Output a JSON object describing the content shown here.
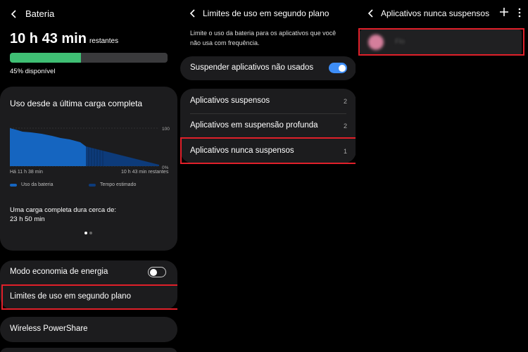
{
  "battery": {
    "title": "Bateria",
    "time_big": "10 h 43 min",
    "time_suffix": "restantes",
    "level_percent": 45,
    "available": "45% disponível",
    "usage_card": {
      "title": "Uso desde a última carga completa",
      "y_top": "100",
      "y_bottom": "0%",
      "x_start": "Há 11 h 38 min",
      "x_end": "10 h 43 min restantes",
      "legend_used": "Uso da bateria",
      "legend_est": "Tempo estimado",
      "full_charge_text": "Uma carga completa dura cerca de:",
      "full_charge_value": "23 h 50 min"
    },
    "power_saving": "Modo economia de energia",
    "background_limits": "Limites de uso em segundo plano",
    "wireless": "Wireless PowerShare"
  },
  "limits": {
    "title": "Limites de uso em segundo plano",
    "description": "Limite o uso da bateria para os aplicativos que você não usa com frequência.",
    "suspend_unused": "Suspender aplicativos não usados",
    "items": [
      {
        "label": "Aplicativos suspensos",
        "count": "2"
      },
      {
        "label": "Aplicativos em suspensão profunda",
        "count": "2"
      },
      {
        "label": "Aplicativos nunca suspensos",
        "count": "1"
      }
    ]
  },
  "never": {
    "title": "Aplicativos nunca suspensos",
    "app_label": "Flo"
  },
  "colors": {
    "battery_green": "#3fbf74",
    "chart_blue": "#1565c0",
    "toggle_blue": "#3e8ef7",
    "highlight_red": "#e0202a"
  },
  "icons": [
    "back-arrow-icon",
    "plus-icon",
    "more-vertical-icon"
  ]
}
